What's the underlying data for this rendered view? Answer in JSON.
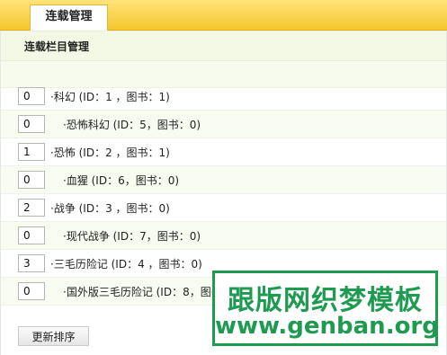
{
  "tabs": [
    {
      "label": "连载管理"
    }
  ],
  "panel": {
    "title": "连载栏目管理"
  },
  "categories": [
    {
      "order": "0",
      "label": "·科幻 (ID：1 ，图书：1)",
      "level": 0
    },
    {
      "order": "0",
      "label": "·恐怖科幻 (ID：5，图书：0)",
      "level": 1
    },
    {
      "order": "1",
      "label": "·恐怖 (ID：2 ，图书：1)",
      "level": 0
    },
    {
      "order": "0",
      "label": "·血猩 (ID：6，图书：0)",
      "level": 1
    },
    {
      "order": "2",
      "label": "·战争 (ID：3 ，图书：0)",
      "level": 0
    },
    {
      "order": "0",
      "label": "·现代战争 (ID：7，图书：0)",
      "level": 1
    },
    {
      "order": "3",
      "label": "·三毛历险记 (ID：4 ，图书：0)",
      "level": 0
    },
    {
      "order": "0",
      "label": "·国外版三毛历险记 (ID：8，图书：0)",
      "level": 1
    }
  ],
  "footer": {
    "update_label": "更新排序"
  },
  "watermark": {
    "line1": "跟版网织梦模板",
    "line2": "www.genban.org"
  },
  "colors": {
    "tabbar": "#f5c62c",
    "header_bg": "#f3f9e4",
    "watermark_green": "#1f9b51"
  }
}
